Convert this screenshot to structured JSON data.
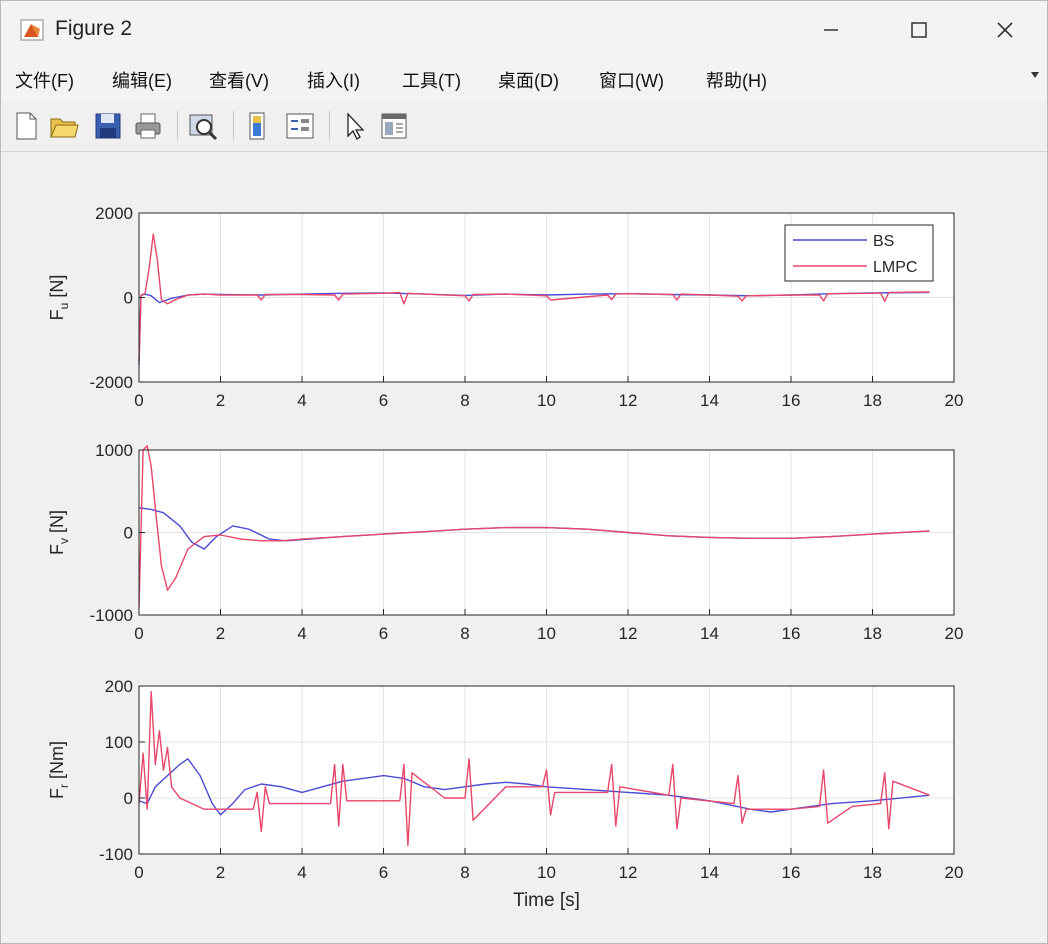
{
  "window": {
    "title": "Figure 2"
  },
  "menu": [
    "文件(F)",
    "编辑(E)",
    "查看(V)",
    "插入(I)",
    "工具(T)",
    "桌面(D)",
    "窗口(W)",
    "帮助(H)"
  ],
  "toolbar": {
    "icons": [
      "new-figure-icon",
      "open-file-icon",
      "save-icon",
      "print-icon",
      "zoom-icon",
      "colorbar-icon",
      "legend-icon",
      "pointer-icon",
      "property-editor-icon"
    ]
  },
  "colors": {
    "BS": "#4b4bd6",
    "LMPC": "#e8466a"
  },
  "chart_data": [
    {
      "type": "line",
      "ylabel": "F_u [N]",
      "xlabel": "",
      "xlim": [
        0,
        20
      ],
      "ylim": [
        -2000,
        2000
      ],
      "xticks": [
        0,
        2,
        4,
        6,
        8,
        10,
        12,
        14,
        16,
        18,
        20
      ],
      "yticks": [
        -2000,
        0,
        2000
      ],
      "grid": true,
      "legend": {
        "position": "top-right",
        "entries": [
          "BS",
          "LMPC"
        ]
      },
      "series": [
        {
          "name": "BS",
          "x": [
            0,
            0.05,
            0.15,
            0.3,
            0.5,
            0.8,
            1.2,
            1.6,
            2.0,
            3.0,
            4.0,
            5.0,
            6.0,
            7.0,
            8.0,
            9.0,
            10.0,
            11.0,
            12.0,
            13.0,
            14.0,
            15.0,
            16.0,
            17.0,
            18.0,
            19.4
          ],
          "y": [
            -1600,
            50,
            80,
            40,
            -120,
            -20,
            60,
            80,
            70,
            60,
            80,
            100,
            110,
            80,
            50,
            80,
            60,
            80,
            90,
            70,
            60,
            40,
            60,
            90,
            110,
            120
          ]
        },
        {
          "name": "LMPC",
          "x": [
            0,
            0.05,
            0.15,
            0.25,
            0.35,
            0.45,
            0.55,
            0.7,
            0.9,
            1.2,
            1.6,
            2.0,
            2.9,
            3.0,
            3.1,
            4.0,
            4.8,
            4.9,
            5.0,
            6.0,
            6.4,
            6.5,
            6.6,
            7.0,
            8.0,
            8.1,
            8.2,
            9.0,
            10.0,
            10.1,
            11.5,
            11.6,
            11.7,
            12.0,
            13.1,
            13.2,
            13.3,
            14.0,
            14.7,
            14.8,
            14.9,
            16.0,
            16.7,
            16.8,
            16.9,
            18.0,
            18.2,
            18.3,
            18.4,
            19.4
          ],
          "y": [
            -1500,
            50,
            100,
            700,
            1500,
            900,
            -50,
            -150,
            -50,
            60,
            80,
            60,
            60,
            -60,
            70,
            70,
            60,
            -60,
            80,
            100,
            120,
            -150,
            100,
            80,
            40,
            -80,
            70,
            80,
            40,
            -60,
            60,
            -50,
            80,
            90,
            70,
            -60,
            80,
            60,
            30,
            -80,
            40,
            60,
            60,
            -80,
            90,
            100,
            110,
            -90,
            120,
            130
          ]
        }
      ]
    },
    {
      "type": "line",
      "ylabel": "F_v [N]",
      "xlabel": "",
      "xlim": [
        0,
        20
      ],
      "ylim": [
        -1000,
        1000
      ],
      "xticks": [
        0,
        2,
        4,
        6,
        8,
        10,
        12,
        14,
        16,
        18,
        20
      ],
      "yticks": [
        -1000,
        0,
        1000
      ],
      "grid": true,
      "series": [
        {
          "name": "BS",
          "x": [
            0,
            0.3,
            0.6,
            1.0,
            1.3,
            1.6,
            1.9,
            2.3,
            2.7,
            3.2,
            3.6,
            4.2,
            5.0,
            6.0,
            7.0,
            8.0,
            9.0,
            10.0,
            11.0,
            12.0,
            13.0,
            14.0,
            15.0,
            16.0,
            17.0,
            18.0,
            19.4
          ],
          "y": [
            300,
            280,
            240,
            80,
            -120,
            -200,
            -50,
            80,
            40,
            -80,
            -100,
            -80,
            -50,
            -20,
            10,
            40,
            60,
            60,
            40,
            0,
            -40,
            -60,
            -70,
            -70,
            -50,
            -20,
            20
          ]
        },
        {
          "name": "LMPC",
          "x": [
            0,
            0.1,
            0.2,
            0.3,
            0.4,
            0.55,
            0.7,
            0.9,
            1.2,
            1.6,
            2.0,
            2.5,
            3.0,
            3.5,
            4.0,
            5.0,
            6.0,
            7.0,
            8.0,
            9.0,
            10.0,
            11.0,
            12.0,
            13.0,
            14.0,
            15.0,
            16.0,
            17.0,
            18.0,
            19.4
          ],
          "y": [
            -900,
            1000,
            1050,
            800,
            300,
            -400,
            -700,
            -550,
            -200,
            -50,
            -30,
            -80,
            -100,
            -100,
            -80,
            -50,
            -20,
            10,
            40,
            60,
            60,
            40,
            0,
            -40,
            -60,
            -70,
            -70,
            -50,
            -20,
            20
          ]
        }
      ]
    },
    {
      "type": "line",
      "ylabel": "F_r [Nm]",
      "xlabel": "Time [s]",
      "xlim": [
        0,
        20
      ],
      "ylim": [
        -100,
        200
      ],
      "xticks": [
        0,
        2,
        4,
        6,
        8,
        10,
        12,
        14,
        16,
        18,
        20
      ],
      "yticks": [
        -100,
        0,
        100,
        200
      ],
      "grid": true,
      "series": [
        {
          "name": "BS",
          "x": [
            0,
            0.2,
            0.4,
            0.7,
            1.0,
            1.2,
            1.5,
            1.8,
            2.0,
            2.3,
            2.6,
            3.0,
            3.5,
            4.0,
            4.5,
            5.0,
            5.5,
            6.0,
            6.5,
            7.0,
            7.5,
            8.0,
            8.5,
            9.0,
            9.5,
            10.0,
            11.0,
            12.0,
            13.0,
            14.0,
            15.0,
            15.5,
            16.0,
            17.0,
            18.0,
            19.4
          ],
          "y": [
            -5,
            -10,
            20,
            40,
            60,
            70,
            40,
            -10,
            -30,
            -10,
            15,
            25,
            20,
            10,
            20,
            30,
            35,
            40,
            35,
            20,
            15,
            20,
            25,
            28,
            25,
            20,
            15,
            10,
            5,
            -5,
            -20,
            -25,
            -20,
            -10,
            -5,
            5
          ]
        },
        {
          "name": "LMPC",
          "x": [
            0,
            0.1,
            0.2,
            0.3,
            0.4,
            0.5,
            0.6,
            0.7,
            0.8,
            1.0,
            1.3,
            1.6,
            2.0,
            2.8,
            2.9,
            3.0,
            3.1,
            3.2,
            4.0,
            4.7,
            4.8,
            4.9,
            5.0,
            5.1,
            6.0,
            6.4,
            6.5,
            6.6,
            6.7,
            7.5,
            8.0,
            8.1,
            8.2,
            9.0,
            9.9,
            10.0,
            10.1,
            10.2,
            11.5,
            11.6,
            11.7,
            11.8,
            13.0,
            13.1,
            13.2,
            13.3,
            14.6,
            14.7,
            14.8,
            14.9,
            16.0,
            16.7,
            16.8,
            16.9,
            17.5,
            18.2,
            18.3,
            18.4,
            18.5,
            19.4
          ],
          "y": [
            -10,
            80,
            -20,
            190,
            60,
            120,
            50,
            90,
            20,
            0,
            -10,
            -20,
            -20,
            -20,
            10,
            -60,
            20,
            -10,
            -10,
            -10,
            60,
            -50,
            60,
            -5,
            -5,
            -5,
            60,
            -85,
            45,
            0,
            0,
            70,
            -40,
            20,
            20,
            50,
            -30,
            10,
            10,
            60,
            -50,
            20,
            5,
            60,
            -55,
            0,
            -10,
            40,
            -45,
            -20,
            -20,
            -15,
            50,
            -45,
            -15,
            -10,
            45,
            -55,
            30,
            5
          ]
        }
      ]
    }
  ]
}
